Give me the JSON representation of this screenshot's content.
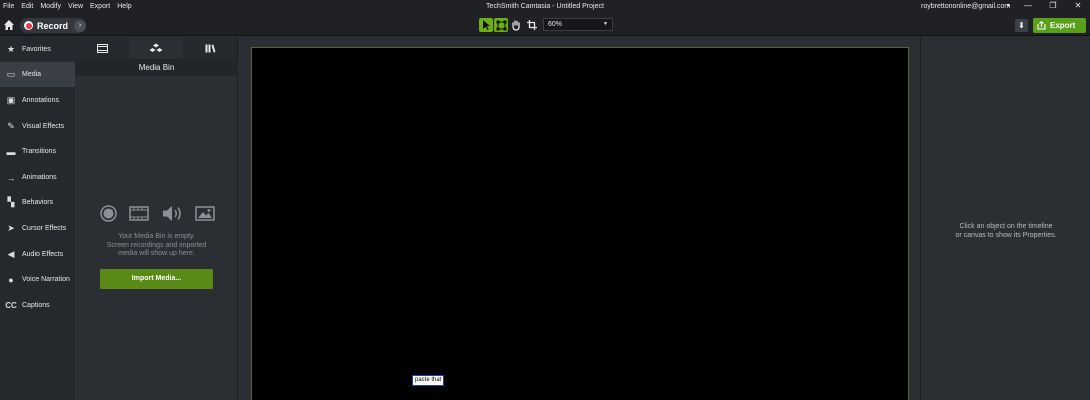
{
  "menubar": {
    "items": [
      "File",
      "Edit",
      "Modify",
      "View",
      "Export",
      "Help"
    ],
    "title": "TechSmith Camtasia - Untitled Project",
    "account": "roybrettononline@gmail.com",
    "account_caret": "▾",
    "window_controls": [
      "—",
      "❐",
      "✕"
    ]
  },
  "toolbar": {
    "record_label": "Record",
    "zoom_value": "60%",
    "export_label": "Export",
    "tools": [
      "select-arrow-icon",
      "edit-nodes-icon",
      "pan-hand-icon",
      "crop-icon"
    ]
  },
  "sidebar": {
    "items": [
      {
        "label": "Favorites",
        "icon": "★"
      },
      {
        "label": "Media",
        "icon": "▭"
      },
      {
        "label": "Annotations",
        "icon": "▣"
      },
      {
        "label": "Visual Effects",
        "icon": "✎"
      },
      {
        "label": "Transitions",
        "icon": "▬"
      },
      {
        "label": "Animations",
        "icon": "→"
      },
      {
        "label": "Behaviors",
        "icon": "▚"
      },
      {
        "label": "Cursor Effects",
        "icon": "➤"
      },
      {
        "label": "Audio Effects",
        "icon": "◀"
      },
      {
        "label": "Voice Narration",
        "icon": "●"
      },
      {
        "label": "Captions",
        "icon": "CC"
      }
    ],
    "active": "Media"
  },
  "bin": {
    "title": "Media Bin",
    "empty_line1": "Your Media Bin is empty.",
    "empty_line2": "Screen recordings and imported",
    "empty_line3": "media will show up here.",
    "import_label": "Import Media..."
  },
  "canvas": {
    "paste_tag": "paste that"
  },
  "properties": {
    "hint_line1": "Click an object on the timeline",
    "hint_line2": "or canvas to show its Properties."
  },
  "colors": {
    "accent": "#5aa01a",
    "record": "#e8384a",
    "background": "#2b2e33"
  }
}
